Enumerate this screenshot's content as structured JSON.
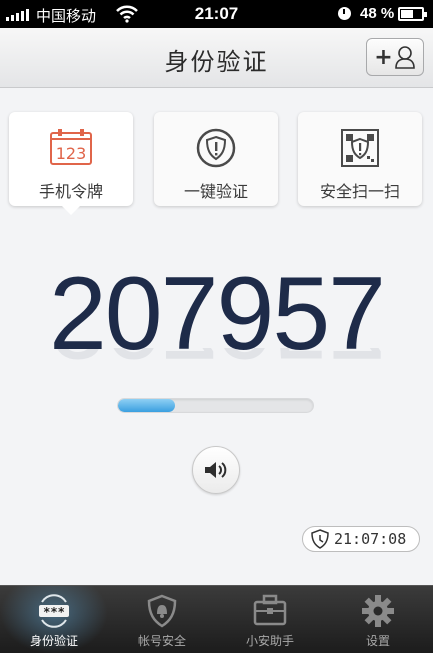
{
  "status_bar": {
    "carrier": "中国移动",
    "time": "21:07",
    "battery": "48 %"
  },
  "nav": {
    "title": "身份验证",
    "add_user_symbol": "+"
  },
  "tabs": [
    {
      "label": "手机令牌",
      "icon_text": "123",
      "active": true
    },
    {
      "label": "一键验证",
      "active": false
    },
    {
      "label": "安全扫一扫",
      "active": false
    }
  ],
  "token": {
    "code": "207957",
    "progress": 0.29
  },
  "timestamp": "21:07:08",
  "tabbar": [
    {
      "label": "身份验证",
      "icon_text": "***",
      "active": true
    },
    {
      "label": "帐号安全",
      "active": false
    },
    {
      "label": "小安助手",
      "active": false
    },
    {
      "label": "设置",
      "active": false
    }
  ],
  "colors": {
    "accent_orange": "#e0654a",
    "token_navy": "#1e2b49",
    "progress_blue": "#3a9fe0"
  }
}
